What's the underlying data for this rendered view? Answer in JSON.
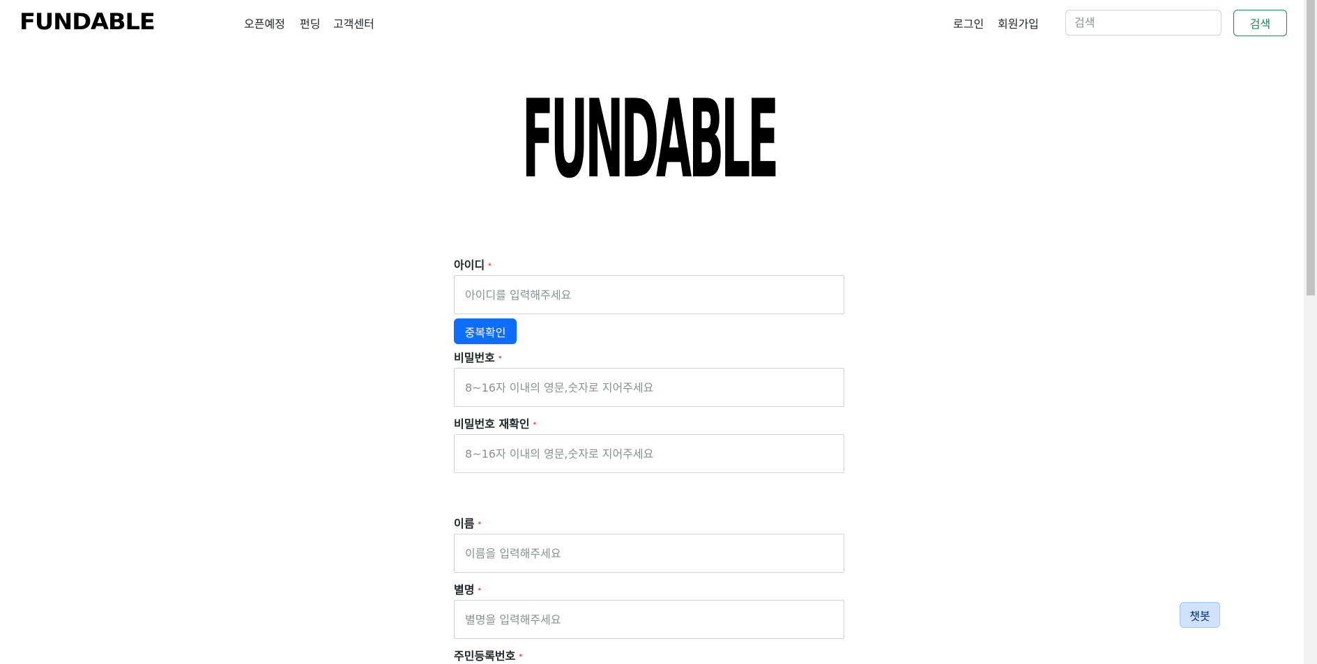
{
  "navbar": {
    "brand": "FUNDABLE",
    "menu": [
      {
        "label": "오픈예정"
      },
      {
        "label": "펀딩"
      },
      {
        "label": "고객센터"
      }
    ],
    "login_label": "로그인",
    "signup_label": "회원가입",
    "search_placeholder": "검색",
    "search_button_label": "검색"
  },
  "hero": {
    "logo_text": "FUNDABLE"
  },
  "form": {
    "required_mark": "*",
    "id_label": "아이디",
    "id_placeholder": "아이디를 입력해주세요",
    "dup_check_label": "중복확인",
    "password_label": "비밀번호",
    "password_placeholder": "8~16자 이내의 영문,숫자로 지어주세요",
    "password_confirm_label": "비밀번호 재확인",
    "password_confirm_placeholder": "8~16자 이내의 영문,숫자로 지어주세요",
    "name_label": "이름",
    "name_placeholder": "이름을 입력해주세요",
    "nickname_label": "별명",
    "nickname_placeholder": "별명을 입력해주세요",
    "resident_number_label": "주민등록번호"
  },
  "chatbot_label": "챗봇"
}
